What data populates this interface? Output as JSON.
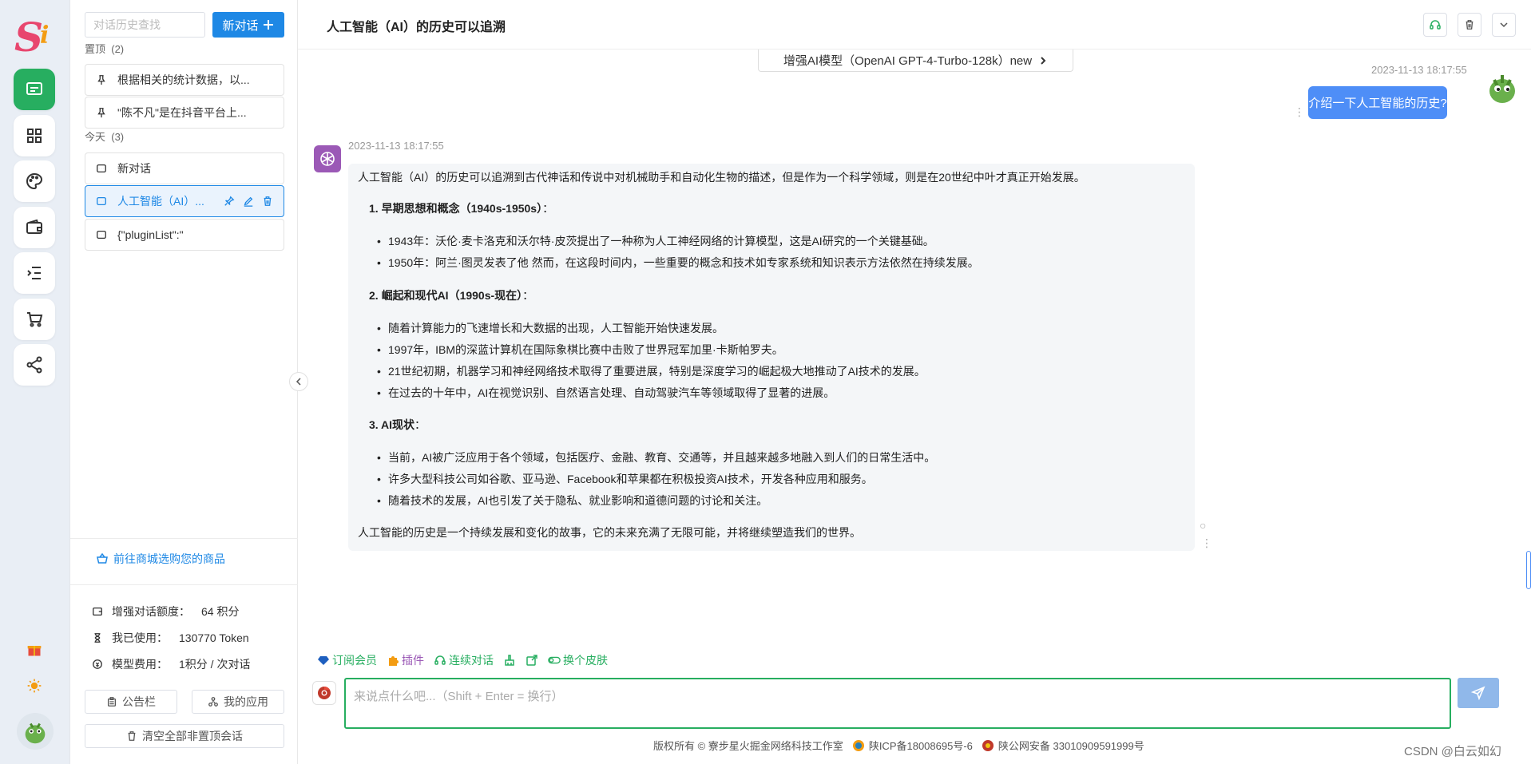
{
  "sidebar": {
    "search_placeholder": "对话历史查找",
    "new_chat_label": "新对话",
    "pinned_label": "置顶",
    "pinned_count": "(2)",
    "today_label": "今天",
    "today_count": "(3)",
    "pinned": [
      {
        "title": "根据相关的统计数据，以..."
      },
      {
        "title": "\"陈不凡\"是在抖音平台上..."
      }
    ],
    "today": [
      {
        "title": "新对话"
      },
      {
        "title": "人工智能（AI）..."
      },
      {
        "title": "{\"pluginList\":\""
      }
    ],
    "shop_link": "前往商城选购您的商品",
    "stats": [
      {
        "label": "增强对话额度：",
        "value": "64 积分"
      },
      {
        "label": "我已使用：",
        "value": "130770 Token"
      },
      {
        "label": "模型费用：",
        "value": "1积分 / 次对话"
      }
    ],
    "notice_label": "公告栏",
    "apps_label": "我的应用",
    "clear_label": "清空全部非置顶会话"
  },
  "header": {
    "title": "人工智能（AI）的历史可以追溯"
  },
  "model": {
    "label": "增强AI模型（OpenAI GPT-4-Turbo-128k）new"
  },
  "user_message": {
    "time": "2023-11-13 18:17:55",
    "text": "介绍一下人工智能的历史?"
  },
  "bot_message": {
    "time": "2023-11-13 18:17:55",
    "intro": "人工智能（AI）的历史可以追溯到古代神话和传说中对机械助手和自动化生物的描述，但是作为一个科学领域，则是在20世纪中叶才真正开始发展。",
    "sections": [
      {
        "heading": "1. 早期思想和概念（1940s-1950s）",
        "items": [
          "1943年：沃伦·麦卡洛克和沃尔特·皮茨提出了一种称为人工神经网络的计算模型，这是AI研究的一个关键基础。",
          "1950年：阿兰·图灵发表了他 然而，在这段时间内，一些重要的概念和技术如专家系统和知识表示方法依然在持续发展。"
        ]
      },
      {
        "heading": "2. 崛起和现代AI（1990s-现在）",
        "items": [
          "随着计算能力的飞速增长和大数据的出现，人工智能开始快速发展。",
          "1997年，IBM的深蓝计算机在国际象棋比赛中击败了世界冠军加里·卡斯帕罗夫。",
          "21世纪初期，机器学习和神经网络技术取得了重要进展，特别是深度学习的崛起极大地推动了AI技术的发展。",
          "在过去的十年中，AI在视觉识别、自然语言处理、自动驾驶汽车等领域取得了显著的进展。"
        ]
      },
      {
        "heading": "3. AI现状",
        "items": [
          "当前，AI被广泛应用于各个领域，包括医疗、金融、教育、交通等，并且越来越多地融入到人们的日常生活中。",
          "许多大型科技公司如谷歌、亚马逊、Facebook和苹果都在积极投资AI技术，开发各种应用和服务。",
          "随着技术的发展，AI也引发了关于隐私、就业影响和道德问题的讨论和关注。"
        ]
      }
    ],
    "outro": "人工智能的历史是一个持续发展和变化的故事，它的未来充满了无限可能，并将继续塑造我们的世界。"
  },
  "tools": [
    {
      "label": "订阅会员",
      "color": "#27ae60",
      "icon": "diamond-icon"
    },
    {
      "label": "插件",
      "color": "#9b59b6",
      "icon": "puzzle-icon"
    },
    {
      "label": "连续对话",
      "color": "#27ae60",
      "icon": "headset-icon"
    },
    {
      "label": "",
      "color": "#27ae60",
      "icon": "broom-icon"
    },
    {
      "label": "",
      "color": "#27ae60",
      "icon": "export-icon"
    },
    {
      "label": "换个皮肤",
      "color": "#27ae60",
      "icon": "toggle-icon"
    }
  ],
  "input": {
    "placeholder": "来说点什么吧...（Shift + Enter = 换行）"
  },
  "footer": {
    "copyright": "版权所有 ©  寮步星火掘金网络科技工作室",
    "icp": "陕ICP备18008695号-6",
    "police": "陕公网安备 33010909591999号"
  },
  "watermark": "CSDN @白云如幻",
  "colors": {
    "accent": "#27ae60",
    "primary": "#1e88e5",
    "user_bubble": "#4e8ef7"
  }
}
